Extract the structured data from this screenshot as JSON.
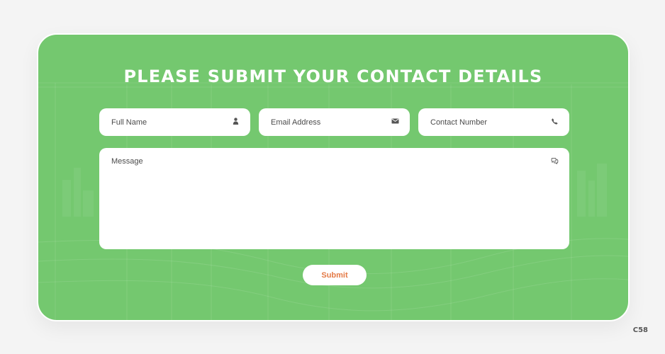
{
  "form": {
    "title": "Please submit your contact details",
    "fields": {
      "full_name": {
        "placeholder": "Full Name",
        "icon": "user-icon"
      },
      "email": {
        "placeholder": "Email Address",
        "icon": "envelope-icon"
      },
      "contact_number": {
        "placeholder": "Contact Number",
        "icon": "phone-icon"
      },
      "message": {
        "placeholder": "Message",
        "icon": "chat-bubbles-icon"
      }
    },
    "submit_label": "Submit"
  },
  "footer": {
    "code": "C58"
  },
  "colors": {
    "card_green": "#74c86f",
    "submit_text": "#e47a46",
    "page_background": "#f4f4f4"
  }
}
